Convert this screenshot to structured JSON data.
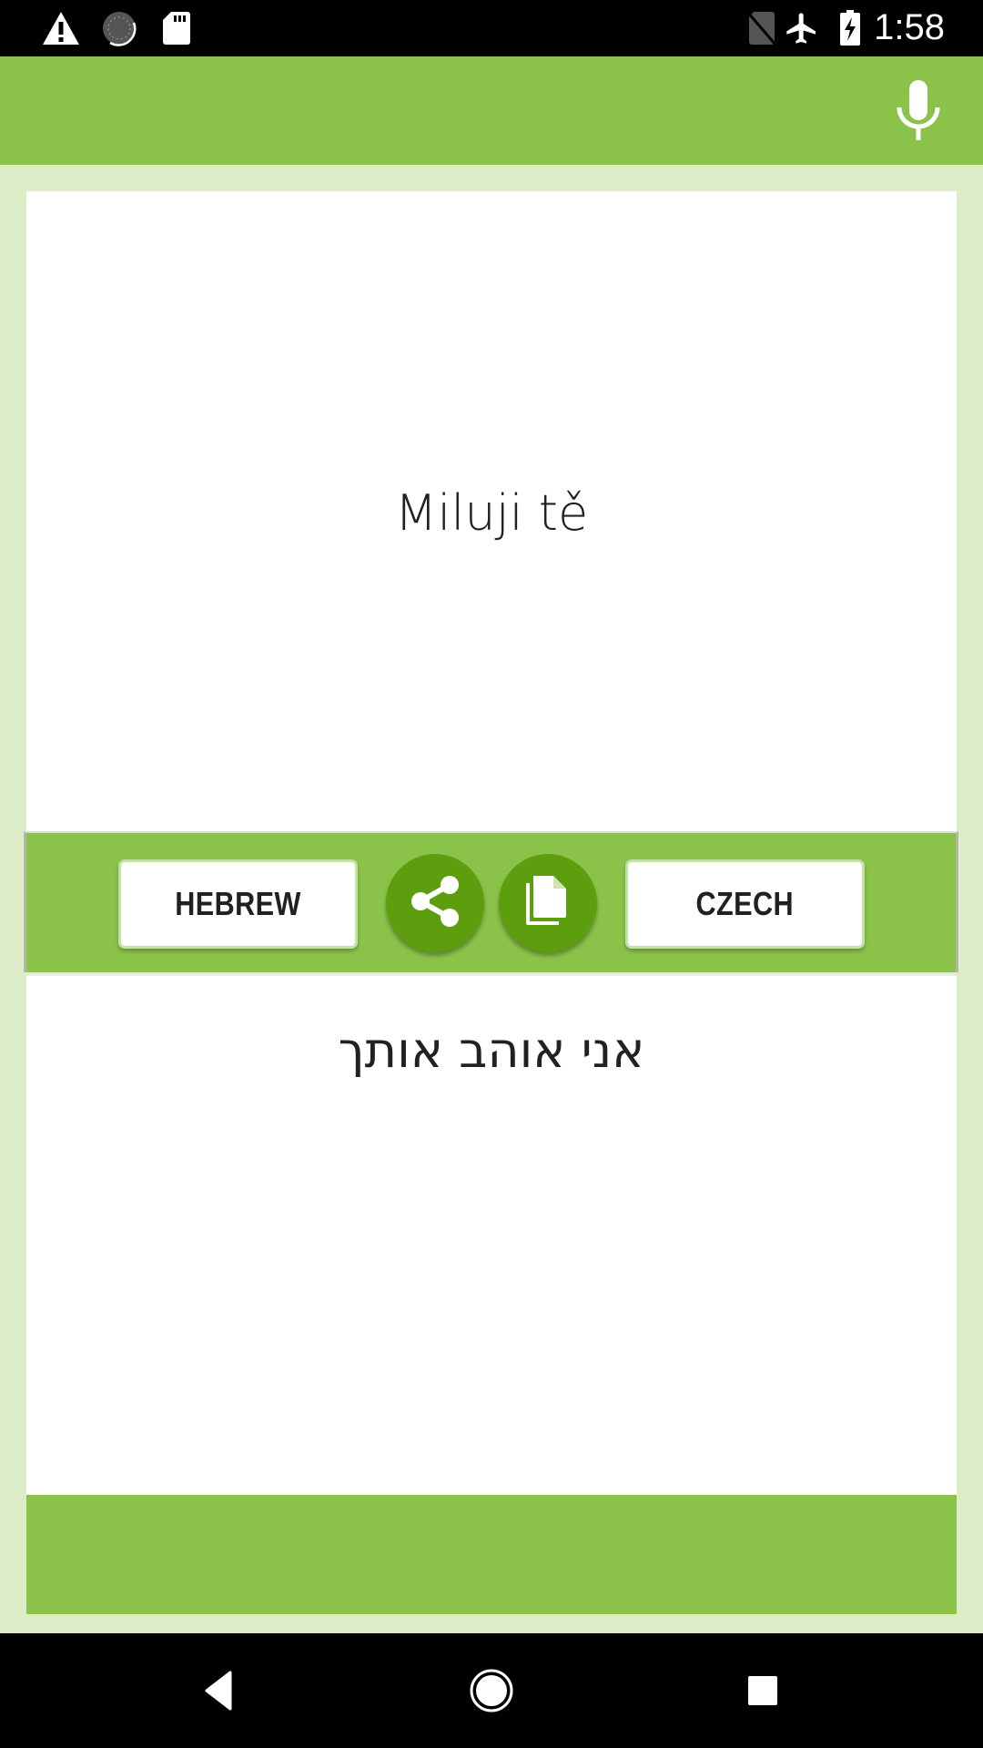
{
  "status_bar": {
    "time": "1:58",
    "left_icons": [
      "warning-icon",
      "sync-circle-icon",
      "sd-card-icon"
    ],
    "right_icons": [
      "no-sim-icon",
      "airplane-mode-icon",
      "battery-charging-icon"
    ]
  },
  "toolbar": {
    "background_color": "#8bc34a",
    "action_icon": "microphone-icon"
  },
  "translator": {
    "source_text": "Miluji tě",
    "target_text": "אני אוהב אותך",
    "left_language_button": "HEBREW",
    "right_language_button": "CZECH",
    "share_icon": "share-icon",
    "copy_icon": "copy-icon"
  },
  "colors": {
    "primary": "#8bc34a",
    "fab": "#5c9e0e",
    "background": "#dcedc8",
    "text": "#212121"
  },
  "nav_bar": {
    "buttons": [
      "back-icon",
      "home-icon",
      "recents-icon"
    ]
  }
}
